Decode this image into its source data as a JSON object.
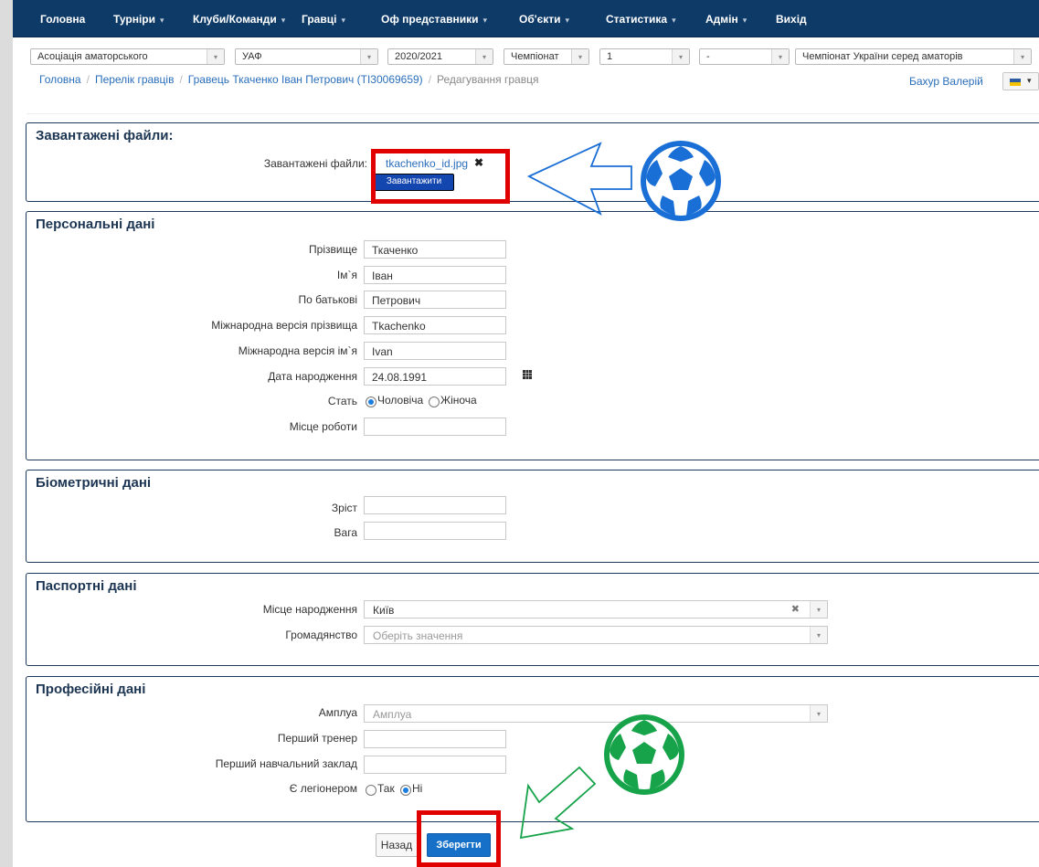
{
  "nav": {
    "items": [
      "Головна",
      "Турніри",
      "Клуби/Команди",
      "Гравці",
      "Оф представники",
      "Об'єкти",
      "Статистика",
      "Адмін",
      "Вихід"
    ]
  },
  "filters": {
    "association": "Асоціація аматорського",
    "federation": "УАФ",
    "season": "2020/2021",
    "competition_type": "Чемпіонат",
    "level": "1",
    "stage": "-",
    "tournament": "Чемпіонат України серед аматорів"
  },
  "breadcrumb": {
    "home": "Головна",
    "players": "Перелік гравців",
    "player": "Гравець Ткаченко Іван Петрович (ТІ30069659)",
    "current": "Редагування гравця"
  },
  "user": {
    "name": "Бахур Валерій"
  },
  "uploads": {
    "title": "Завантажені файли:",
    "label": "Завантажені файли:",
    "file_name": "tkachenko_id.jpg",
    "remove_icon": "✖",
    "upload_button": "Завантажити"
  },
  "personal": {
    "title": "Персональні дані",
    "surname_label": "Прізвище",
    "surname": "Ткаченко",
    "name_label": "Ім`я",
    "name": "Іван",
    "patronymic_label": "По батькові",
    "patronymic": "Петрович",
    "intl_surname_label": "Міжнародна версія прізвища",
    "intl_surname": "Tkachenko",
    "intl_name_label": "Міжнародна версія ім`я",
    "intl_name": "Ivan",
    "birth_label": "Дата народження",
    "birth": "24.08.1991",
    "gender_label": "Стать",
    "gender_male": "Чоловіча",
    "gender_female": "Жіноча",
    "work_label": "Місце роботи",
    "work": ""
  },
  "biometric": {
    "title": "Біометричні дані",
    "height_label": "Зріст",
    "height": "",
    "weight_label": "Вага",
    "weight": ""
  },
  "passport": {
    "title": "Паспортні дані",
    "birthplace_label": "Місце народження",
    "birthplace": "Київ",
    "citizenship_label": "Громадянство",
    "citizenship_placeholder": "Оберіть значення"
  },
  "professional": {
    "title": "Професійні дані",
    "role_label": "Амплуа",
    "role_placeholder": "Амплуа",
    "coach_label": "Перший тренер",
    "coach": "",
    "school_label": "Перший навчальний заклад",
    "school": "",
    "legionnaire_label": "Є легіонером",
    "yes": "Так",
    "no": "Ні"
  },
  "actions": {
    "back": "Назад",
    "save": "Зберегти"
  },
  "colors": {
    "navbar": "#0e3a68",
    "highlight": "#e00000",
    "blue_arrow": "#1a6fd6",
    "green_arrow": "#16a34a"
  }
}
